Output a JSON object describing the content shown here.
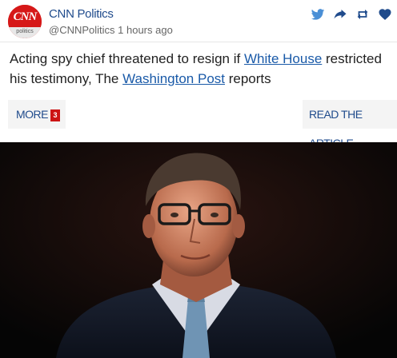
{
  "post": {
    "logo": {
      "top_text": "CNN",
      "bottom_text": "politics"
    },
    "author_name": "CNN Politics",
    "author_meta": "@CNNPolitics 1 hours ago",
    "actions": [
      {
        "name": "twitter-icon"
      },
      {
        "name": "share-icon"
      },
      {
        "name": "retweet-icon"
      },
      {
        "name": "heart-icon"
      }
    ],
    "headline": {
      "part1": "Acting spy chief threatened to resign if ",
      "link1": "White House",
      "part2": " restricted his testimony, The ",
      "link2": "Washington Post",
      "part3": " reports"
    },
    "more_label": "MORE",
    "more_count": "3",
    "read_label": "READ THE ARTICLE"
  },
  "colors": {
    "accent_blue": "#1f4b8c",
    "link_blue": "#1a5aa8",
    "badge_red": "#cc1414",
    "brand_red": "#cc0000"
  }
}
